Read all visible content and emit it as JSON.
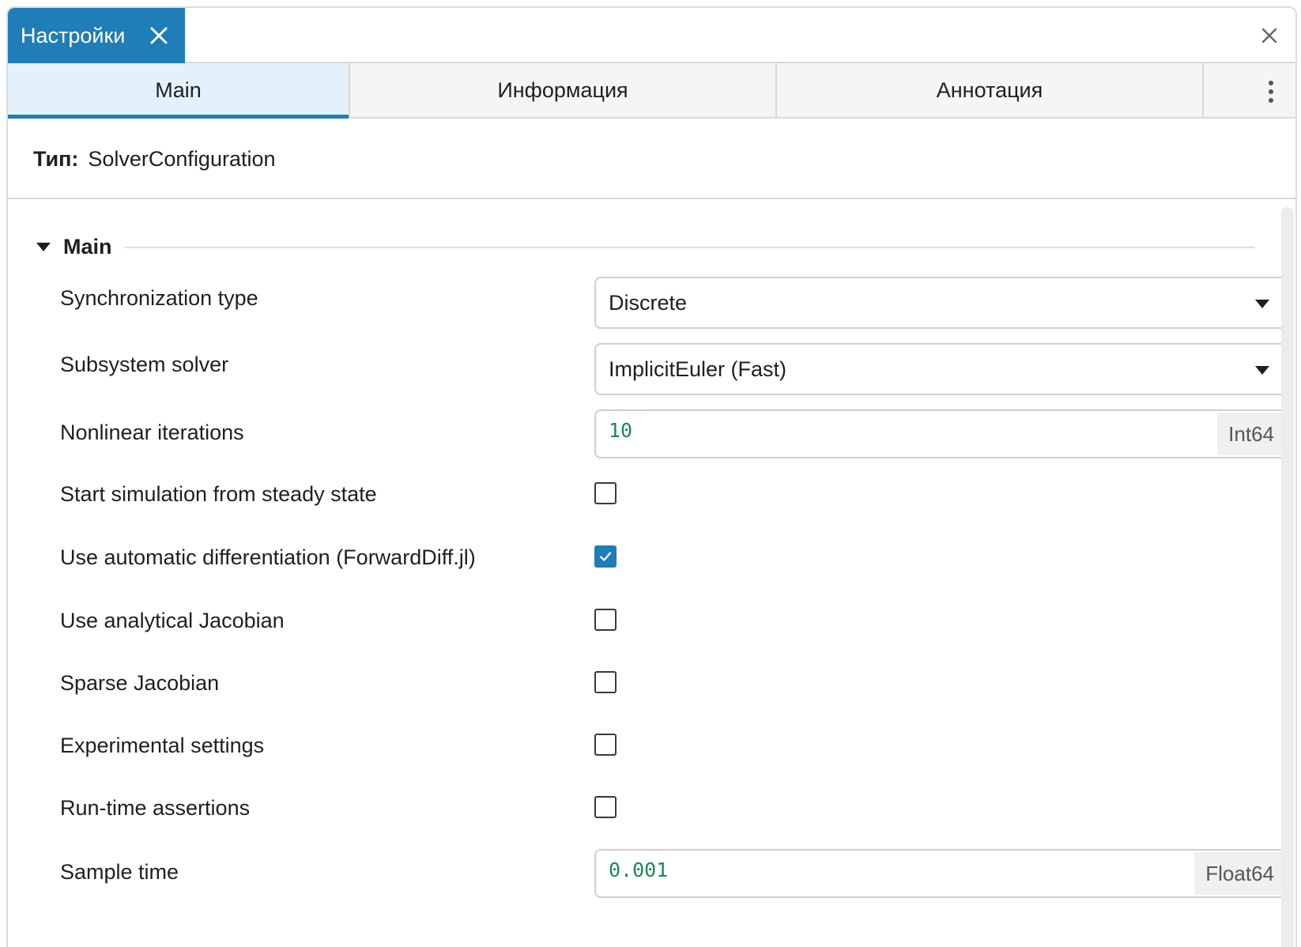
{
  "window": {
    "tab_title": "Настройки",
    "tabs": [
      {
        "label": "Main",
        "active": true
      },
      {
        "label": "Информация",
        "active": false
      },
      {
        "label": "Аннотация",
        "active": false
      }
    ]
  },
  "type_row": {
    "label": "Тип:",
    "value": "SolverConfiguration"
  },
  "section": {
    "title": "Main",
    "expanded": true
  },
  "fields": {
    "sync_type": {
      "label": "Synchronization type",
      "value": "Discrete"
    },
    "subsystem_solver": {
      "label": "Subsystem solver",
      "value": "ImplicitEuler (Fast)"
    },
    "nonlinear_iterations": {
      "label": "Nonlinear iterations",
      "value": "10",
      "type": "Int64"
    },
    "steady_state": {
      "label": "Start simulation from steady state",
      "checked": false
    },
    "autodiff": {
      "label": "Use automatic differentiation (ForwardDiff.jl)",
      "checked": true
    },
    "analytical_jacobian": {
      "label": "Use analytical Jacobian",
      "checked": false
    },
    "sparse_jacobian": {
      "label": "Sparse Jacobian",
      "checked": false
    },
    "experimental": {
      "label": "Experimental settings",
      "checked": false
    },
    "runtime_assertions": {
      "label": "Run-time assertions",
      "checked": false
    },
    "sample_time": {
      "label": "Sample time",
      "value": "0.001",
      "type": "Float64"
    }
  },
  "icons": {
    "tab_close": "close-icon",
    "panel_close": "close-icon",
    "more": "more-vertical-icon",
    "collapse": "caret-down-icon",
    "dropdown": "chevron-down-icon",
    "check": "checkmark-icon"
  },
  "colors": {
    "accent": "#1f7db8",
    "active_tab_bg": "#e3f1fb",
    "value_text": "#1a8a55"
  }
}
